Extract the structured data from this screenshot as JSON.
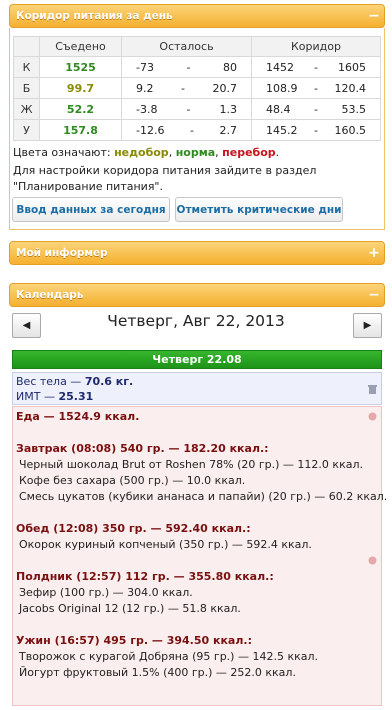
{
  "corridor_panel": {
    "title": "Коридор питания за день",
    "toggle": "−",
    "columns": [
      "",
      "Съедено",
      "Осталось",
      "Коридор"
    ],
    "rows": [
      {
        "label": "К",
        "eaten": "1525",
        "left_min": "-73",
        "left_max": "80",
        "cor_min": "1452",
        "cor_max": "1605",
        "color": "green"
      },
      {
        "label": "Б",
        "eaten": "99.7",
        "left_min": "9.2",
        "left_max": "20.7",
        "cor_min": "108.9",
        "cor_max": "120.4",
        "color": "olive"
      },
      {
        "label": "Ж",
        "eaten": "52.2",
        "left_min": "-3.8",
        "left_max": "1.3",
        "cor_min": "48.4",
        "cor_max": "53.5",
        "color": "green"
      },
      {
        "label": "У",
        "eaten": "157.8",
        "left_min": "-12.6",
        "left_max": "2.7",
        "cor_min": "145.2",
        "cor_max": "160.5",
        "color": "green"
      }
    ],
    "dash": "-",
    "legend_prefix": "Цвета означают:",
    "legend_under": "недобор",
    "legend_norm": "норма",
    "legend_over": "перебор",
    "legend_sep": ",",
    "legend_end": ".",
    "hint_line1": "Для настройки коридора питания зайдите в раздел",
    "hint_line2": "\"Планирование питания\".",
    "btn_today": "Ввод данных за сегодня",
    "btn_critical": "Отметить критические дни",
    "colors": {
      "green": "#2f8a1f",
      "olive": "#8a8a00",
      "red": "#c8141e",
      "accent": "#f5b02f"
    }
  },
  "informer_panel": {
    "title": "Мой информер",
    "toggle": "+"
  },
  "calendar_panel": {
    "title": "Календарь",
    "toggle": "−",
    "prev": "◀",
    "next": "▶",
    "date_title": "Четверг, Авг 22, 2013",
    "day_bar": "Четверг  22.08",
    "weight_label": "Вес тела",
    "weight_value": "70.6 кг.",
    "bmi_label": "ИМТ",
    "bmi_value": "25.31",
    "food_label": "Еда",
    "food_value": "1524.9 ккал.",
    "meals": [
      {
        "title": "Завтрак (08:08) 540 гр. — 182.20 ккал.:",
        "items": [
          "Черный шоколад Brut от Roshen 78% (20 гр.) — 112.0 ккал.",
          "Кофе без сахара (500 гр.) — 10.0 ккал.",
          "Смесь цукатов (кубики ананаса и папайи) (20 гр.) — 60.2 ккал."
        ]
      },
      {
        "title": "Обед (12:08) 350 гр. — 592.40 ккал.:",
        "items": [
          "Окорок куриный копченый (350 гр.) — 592.4 ккал."
        ]
      },
      {
        "title": "Полдник (12:57) 112 гр. — 355.80 ккал.:",
        "items": [
          "Зефир (100 гр.) — 304.0 ккал.",
          "Jacobs Original 12 (12 гр.) — 51.8 ккал."
        ]
      },
      {
        "title": "Ужин (16:57) 495 гр. — 394.50 ккал.:",
        "items": [
          "Творожок с курагой Добряна (95 гр.) — 142.5 ккал.",
          "Йогурт фруктовый 1.5% (400 гр.) — 252.0 ккал."
        ]
      }
    ]
  }
}
